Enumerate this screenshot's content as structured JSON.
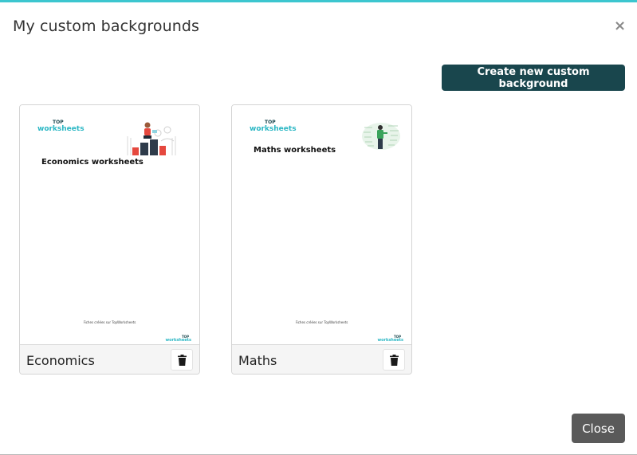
{
  "modal": {
    "title": "My custom backgrounds",
    "close_icon": "close-icon",
    "close_glyph": "×"
  },
  "toolbar": {
    "create_label": "Create new custom background"
  },
  "cards": [
    {
      "name": "Economics",
      "sheet_title": "Economics worksheets",
      "logo_top": "TOP",
      "logo_main": "worksheets",
      "footnote": "Fiches créées sur TopWorksheets",
      "mini_logo_top": "TOP",
      "mini_logo_main": "worksheets",
      "illustration": "economics-illustration",
      "delete_icon": "trash-icon"
    },
    {
      "name": "Maths",
      "sheet_title": "Maths worksheets",
      "logo_top": "TOP",
      "logo_main": "worksheets",
      "footnote": "Fiches créées sur TopWorksheets",
      "mini_logo_top": "TOP",
      "mini_logo_main": "worksheets",
      "illustration": "maths-illustration",
      "delete_icon": "trash-icon"
    }
  ],
  "footer": {
    "close_label": "Close"
  },
  "colors": {
    "accent_top_border": "#3cc6cf",
    "primary_button": "#19464d",
    "close_button": "#5a5a5a",
    "logo_teal": "#2bb7c4"
  }
}
